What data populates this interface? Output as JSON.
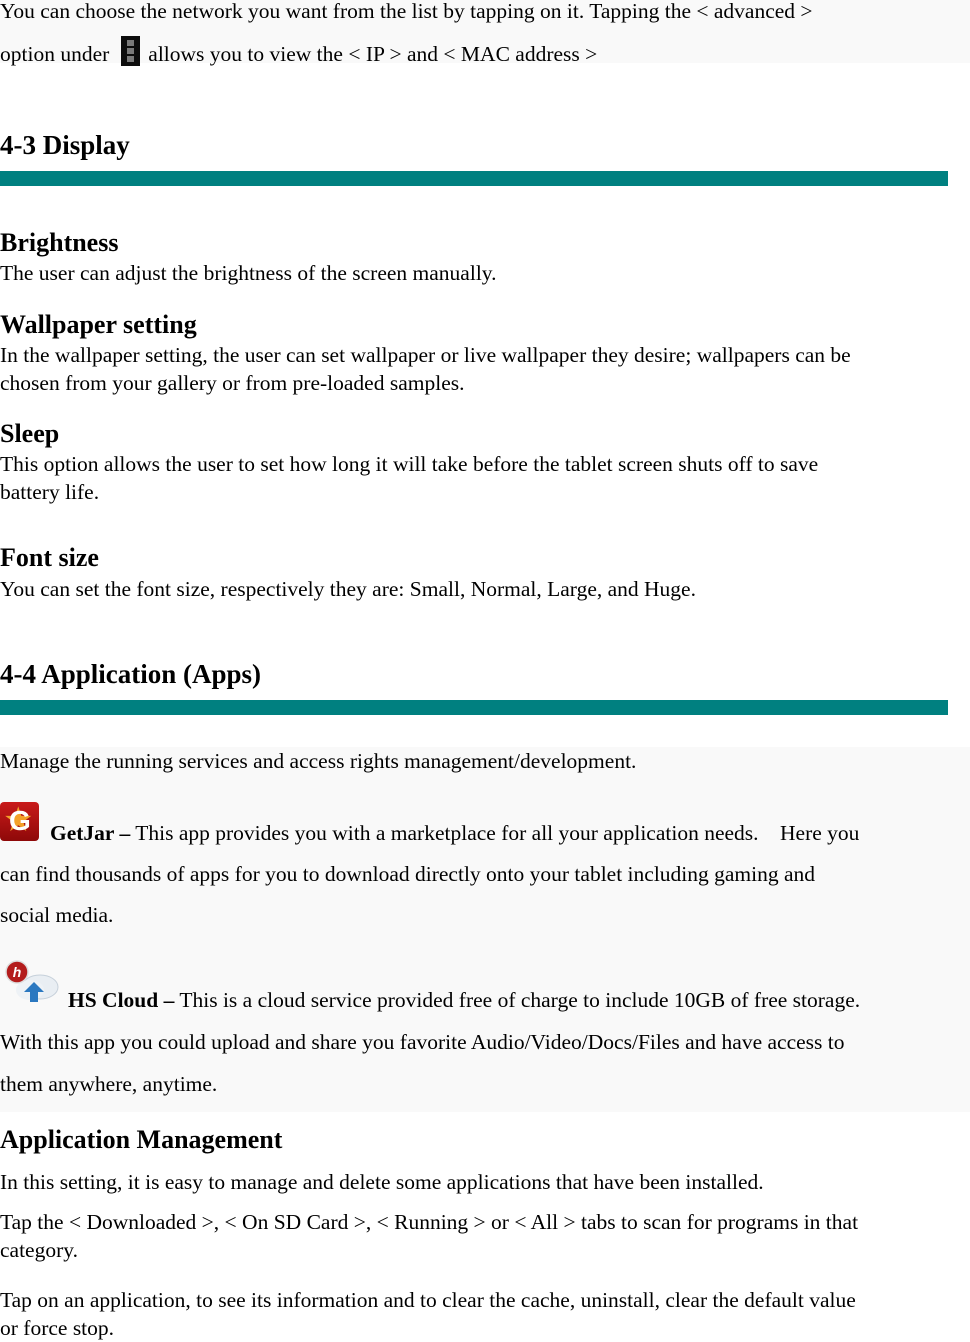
{
  "intro": {
    "line1": "You can choose the network you want from the list by tapping on it. Tapping the < advanced >",
    "line2_before_icon": "option under",
    "line2_icon": "overflow-menu-icon",
    "line2_after_icon": "allows you to view the < IP > and < MAC address >"
  },
  "section_display": {
    "title": "4-3 Display",
    "rule_color": "#008080",
    "items": [
      {
        "heading": "Brightness",
        "lines": [
          "The user can adjust the brightness of the screen manually."
        ]
      },
      {
        "heading": "Wallpaper setting",
        "lines": [
          "In the wallpaper setting, the user can set wallpaper or live wallpaper they desire; wallpapers can be",
          "chosen from your gallery or from pre-loaded samples."
        ]
      },
      {
        "heading": "Sleep",
        "lines": [
          "This option allows the user to set how long it will take before the tablet screen shuts off to save",
          "battery life."
        ]
      },
      {
        "heading": "Font size",
        "lines": [
          "You can set the font size, respectively they are: Small, Normal, Large, and Huge."
        ]
      }
    ]
  },
  "section_apps": {
    "title": "4-4 Application (Apps)",
    "rule_color": "#008080",
    "intro": "Manage the running services and access rights management/development.",
    "apps": [
      {
        "icon": "getjar-icon",
        "name": "GetJar –",
        "lines": [
          "This app provides you with a marketplace for all your application needs.    Here you",
          "can find thousands of apps for you to download directly onto your tablet including gaming and",
          "social media."
        ]
      },
      {
        "icon": "hs-cloud-icon",
        "name": "HS Cloud –",
        "lines": [
          "This is a cloud service provided free of charge to include 10GB of free storage.",
          "With this app you could upload and share you favorite Audio/Video/Docs/Files and have access to",
          "them anywhere, anytime."
        ]
      }
    ],
    "management": {
      "heading": "Application Management",
      "para1": "In this setting, it is easy to manage and delete some applications that have been installed.",
      "para2_lines": [
        "Tap the < Downloaded >, < On SD Card >, < Running > or < All > tabs to scan for programs in that",
        "category."
      ],
      "para3_lines": [
        "Tap on an application, to see its information and to clear the cache, uninstall, clear the default value",
        "or force stop."
      ]
    }
  }
}
